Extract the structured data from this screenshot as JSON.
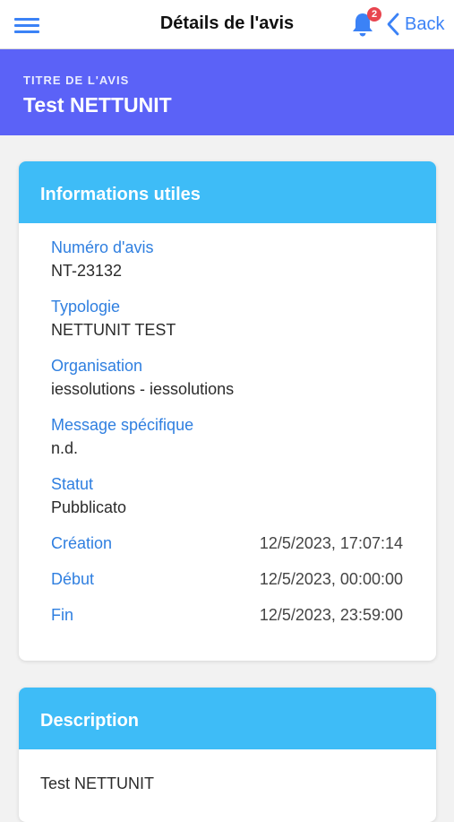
{
  "header": {
    "title": "Détails de l'avis",
    "notification_count": "2",
    "back_label": "Back",
    "menu_icon": "hamburger-icon",
    "bell_icon": "bell-icon",
    "back_icon": "chevron-left-icon"
  },
  "title_band": {
    "label": "TITRE DE L'AVIS",
    "value": "Test NETTUNIT"
  },
  "info_card": {
    "title": "Informations utiles",
    "numero": {
      "label": "Numéro d'avis",
      "value": "NT-23132"
    },
    "typologie": {
      "label": "Typologie",
      "value": "NETTUNIT TEST"
    },
    "organisation": {
      "label": "Organisation",
      "value": "iessolutions - iessolutions"
    },
    "message": {
      "label": "Message spécifique",
      "value": "n.d."
    },
    "statut": {
      "label": "Statut",
      "value": "Pubblicato"
    },
    "creation": {
      "label": "Création",
      "value": "12/5/2023, 17:07:14"
    },
    "debut": {
      "label": "Début",
      "value": "12/5/2023, 00:00:00"
    },
    "fin": {
      "label": "Fin",
      "value": "12/5/2023, 23:59:00"
    }
  },
  "description_card": {
    "title": "Description",
    "text": "Test NETTUNIT"
  },
  "colors": {
    "accent_blue": "#3b82f6",
    "title_band": "#5b62f7",
    "card_header": "#3ebcf7",
    "badge": "#e8454f"
  }
}
